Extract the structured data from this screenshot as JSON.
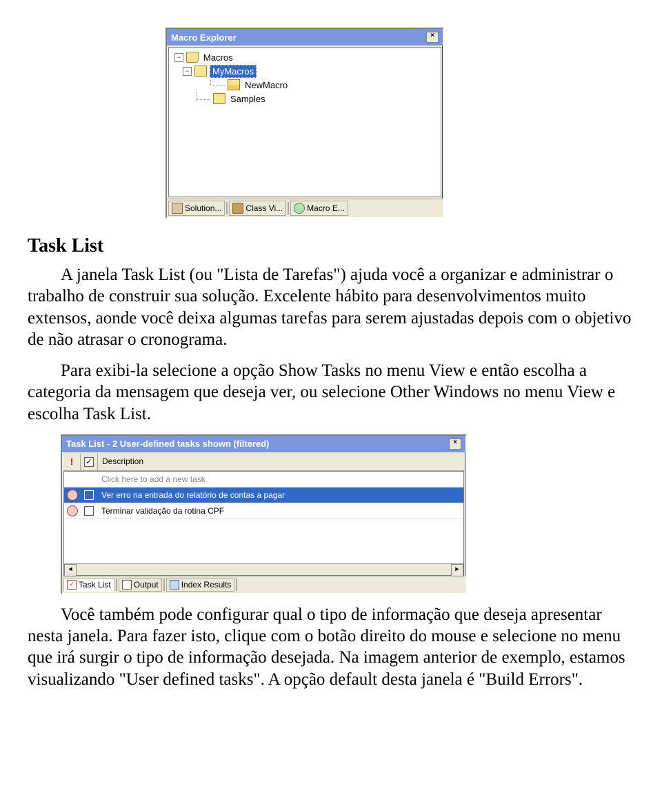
{
  "macro_explorer": {
    "title": "Macro Explorer",
    "close": "×",
    "items": {
      "root": "Macros",
      "selected": "MyMacros",
      "child": "NewMacro",
      "sibling": "Samples",
      "toggle_root": "−",
      "toggle_sel": "−"
    },
    "tabs": {
      "solution": "Solution...",
      "classview": "Class Vi...",
      "macro": "Macro E..."
    }
  },
  "doc": {
    "heading": "Task List",
    "p1": "A janela Task List (ou \"Lista de Tarefas\") ajuda você a organizar e administrar o trabalho de construir sua solução. Excelente hábito para desenvolvimentos muito extensos, aonde você deixa algumas tarefas para serem ajustadas depois com o objetivo de não atrasar o cronograma.",
    "p2": "Para exibi-la selecione a opção Show Tasks no menu View e então escolha a categoria da mensagem que deseja ver, ou selecione Other Windows no menu View e escolha Task List.",
    "p3": "Você também pode configurar qual o tipo de informação que deseja apresentar nesta janela. Para fazer isto, clique com o botão direito do mouse e selecione no menu que irá surgir o tipo de informação desejada. Na imagem anterior de exemplo, estamos visualizando \"User defined tasks\". A opção default desta janela é \"Build Errors\"."
  },
  "task_list": {
    "title": "Task List - 2 User-defined tasks shown (filtered)",
    "close": "×",
    "header": {
      "priority": "!",
      "description": "Description"
    },
    "rows": {
      "placeholder": "Click here to add a new task",
      "r1": "Ver erro na entrada do relatório de contas a pagar",
      "r2": "Terminar validação da rotina CPF"
    },
    "scroll": {
      "left": "◄",
      "right": "►"
    },
    "tabs": {
      "tasklist": "Task List",
      "output": "Output",
      "index": "Index Results",
      "tasklist_check": "✓"
    }
  }
}
